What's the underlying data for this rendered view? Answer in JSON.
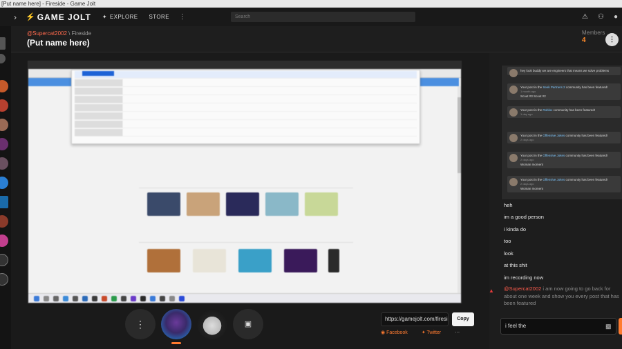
{
  "window": {
    "title": "[Put name here] - Fireside - Game Jolt"
  },
  "nav": {
    "logo": "GAME JOLT",
    "explore": "EXPLORE",
    "store": "STORE",
    "search_placeholder": "Search",
    "icons": [
      "chevron-right-icon",
      "bolt-icon",
      "compass-icon",
      "more-vertical-icon",
      "bell-icon",
      "friends-icon",
      "user-icon"
    ]
  },
  "fireside": {
    "host": "@Supercat2002",
    "section": "Fireside",
    "title": "(Put name here)",
    "members_label": "Members",
    "members_count": "4"
  },
  "share": {
    "url": "https://gamejolt.com/fireside",
    "copy": "Copy",
    "facebook": "Facebook",
    "twitter": "Twitter"
  },
  "chat": {
    "overlay_notifications": [
      {
        "text": "hey look buddy we are engineers that means we solve problems",
        "sub": "",
        "tail": ""
      },
      {
        "text": "Your post in the ",
        "community": "Seek Partners 2",
        "text2": " community has been featured!",
        "sub": "1 month ago",
        "tail": "Scout #3 Scout #2"
      },
      {
        "text": "Your post in the ",
        "community": "Roblox",
        "text2": " community has been featured!",
        "sub": "1 day ago",
        "tail": ""
      },
      {
        "text": "Your post in the ",
        "community": "Offensive Jokes",
        "text2": " community has been featured!",
        "sub": "2 days ago",
        "tail": ""
      },
      {
        "text": "Your post in the ",
        "community": "Offensive Jokes",
        "text2": " community has been featured!",
        "sub": "2 days ago",
        "tail": "Woman moment"
      },
      {
        "text": "Your post in the ",
        "community": "Offensive Jokes",
        "text2": " community has been featured!",
        "sub": "2 days ago",
        "tail": "Woman moment"
      }
    ],
    "messages": [
      "heh",
      "im a good person",
      "i kinda do",
      "too",
      "look",
      "at this shit",
      "im recording now"
    ],
    "big_message": {
      "author": "@Supercat2002",
      "text": "i am now going to go back for about one week and show you every post that has been featured"
    },
    "input_value": "i feel the"
  },
  "colors": {
    "accent": "#ff7b30",
    "handle": "#ff6a4d",
    "members_count": "#ff8a2a",
    "link": "#7ec8ff"
  }
}
